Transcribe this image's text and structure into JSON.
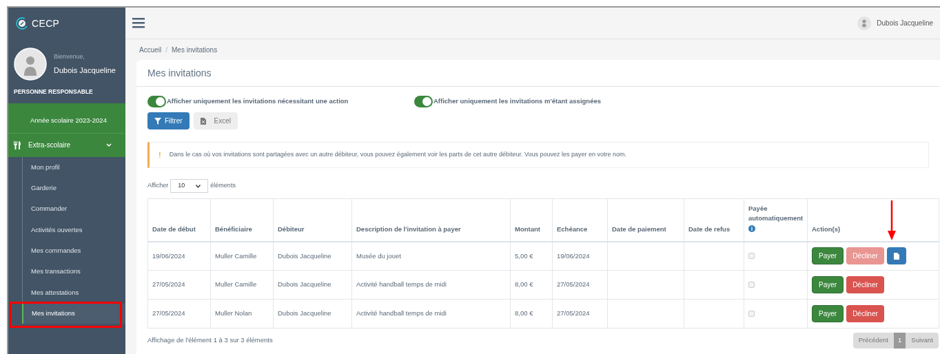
{
  "logo": {
    "text": "CECP"
  },
  "user": {
    "greeting": "Bienvenue,",
    "name": "Dubois Jacqueline",
    "role": "PERSONNE RESPONSABLE"
  },
  "sidebar": {
    "year": "Année scolaire 2023-2024",
    "section": {
      "label": "Extra-scolaire",
      "expanded": true
    },
    "items": [
      {
        "label": "Mon profil",
        "selected": false
      },
      {
        "label": "Garderie",
        "selected": false
      },
      {
        "label": "Commander",
        "selected": false
      },
      {
        "label": "Activités ouvertes",
        "selected": false
      },
      {
        "label": "Mes commandes",
        "selected": false
      },
      {
        "label": "Mes transactions",
        "selected": false
      },
      {
        "label": "Mes attestations",
        "selected": false
      },
      {
        "label": "Mes invitations",
        "selected": true
      }
    ]
  },
  "topbar": {
    "user_name": "Dubois Jacqueline"
  },
  "breadcrumb": {
    "items": [
      "Accueil",
      "Mes invitations"
    ],
    "separator": "/"
  },
  "card": {
    "title": "Mes invitations",
    "toggles": [
      {
        "label": "Afficher uniquement les invitations nécessitant une action",
        "on": true
      },
      {
        "label": "Afficher uniquement les invitations m'étant assignées",
        "on": true
      }
    ],
    "buttons": [
      {
        "kind": "filter",
        "label": "Filtrer"
      },
      {
        "kind": "excel",
        "label": "Excel"
      }
    ],
    "alert": {
      "icon": "!",
      "text": "Dans le cas où vos invitations sont partagées avec un autre débiteur, vous pouvez également voir les parts de cet autre débiteur. Vous pouvez les payer en votre nom."
    },
    "length": {
      "before": "Afficher",
      "value": "10",
      "after": "éléments"
    },
    "table": {
      "columns": [
        "Date de début",
        "Bénéficiaire",
        "Débiteur",
        "Description de l'invitation à payer",
        "Montant",
        "Echéance",
        "Date de paiement",
        "Date de refus",
        "Payée automatiquement",
        "Action(s)"
      ],
      "rows": [
        {
          "cells": [
            "19/06/2024",
            "Muller Camille",
            "Dubois Jacqueline",
            "Musée du jouet",
            "5,00 €",
            "19/06/2024",
            "",
            ""
          ],
          "auto_paid": false,
          "pay": "Payer",
          "decline": "Décliner",
          "decline_disabled": true,
          "document": true
        },
        {
          "cells": [
            "27/05/2024",
            "Muller Camille",
            "Dubois Jacqueline",
            "Activité handball temps de midi",
            "8,00 €",
            "27/05/2024",
            "",
            ""
          ],
          "auto_paid": false,
          "pay": "Payer",
          "decline": "Décliner",
          "decline_disabled": false,
          "document": false
        },
        {
          "cells": [
            "27/05/2024",
            "Muller Nolan",
            "Dubois Jacqueline",
            "Activité handball temps de midi",
            "8,00 €",
            "27/05/2024",
            "",
            ""
          ],
          "auto_paid": false,
          "pay": "Payer",
          "decline": "Décliner",
          "decline_disabled": false,
          "document": false
        }
      ]
    },
    "info": "Affichage de l'élément 1 à 3 sur 3 éléments",
    "pagination": {
      "previous": "Précédent",
      "pages": [
        {
          "label": "1",
          "selected": true
        }
      ],
      "next": "Suivant"
    }
  }
}
